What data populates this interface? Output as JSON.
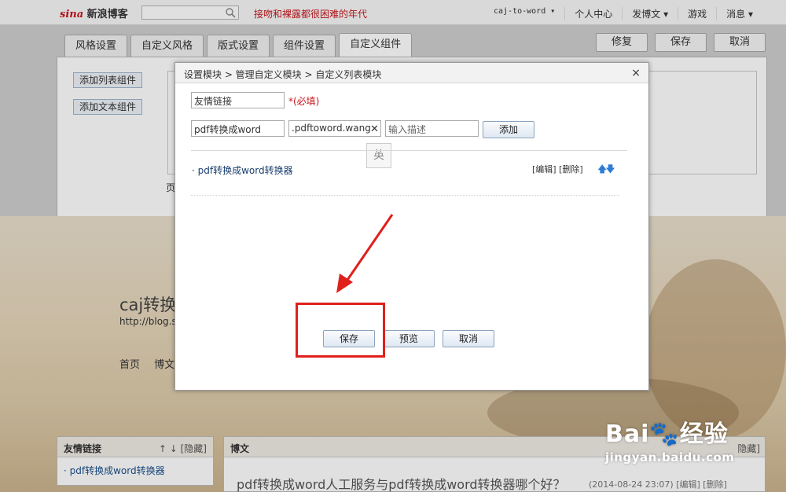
{
  "topbar": {
    "logo_brand": "sina",
    "logo_text": "新浪博客",
    "search_value": "",
    "slogan": "接吻和裸露都很困难的年代",
    "nav": [
      "caj-to-word ▾",
      "个人中心",
      "发博文 ▾",
      "游戏",
      "消息 ▾"
    ]
  },
  "settings": {
    "tabs": [
      "风格设置",
      "自定义风格",
      "版式设置",
      "组件设置",
      "自定义组件"
    ],
    "active_tab": "自定义组件",
    "actions": [
      "修复",
      "保存",
      "取消"
    ],
    "add_list_label": "添加列表组件",
    "add_text_label": "添加文本组件",
    "partial_text": "页"
  },
  "blog": {
    "title": "caj转换",
    "url": "http://blog.s",
    "nav": [
      "首页",
      "博文"
    ],
    "side_title": "友情链接",
    "side_ctl": "↑ ↓ [隐藏]",
    "side_link": "· pdf转换成word转换器",
    "main_title": "博文",
    "main_ctl": "隐藏]",
    "post_title": "pdf转换成word人工服务与pdf转换成word转换器哪个好？",
    "post_meta": "(2014-08-24 23:07) [编辑] [删除]"
  },
  "dialog": {
    "breadcrumb": "设置模块 > 管理自定义模块 > 自定义列表模块",
    "close_label": "×",
    "title_input_value": "友情链接",
    "required_label": "*(必填)",
    "name_input_value": "pdf转换成word",
    "url_input_value": ".pdftoword.wang",
    "desc_input_placeholder": "输入描述",
    "add_button": "添加",
    "ime_label": "英",
    "list_item": "· pdf转换成word转换器",
    "list_ops": "[编辑] [删除]",
    "save_button": "保存",
    "preview_button": "预览",
    "cancel_button": "取消"
  },
  "watermark": {
    "main": "Bai🐾经验",
    "sub": "jingyan.baidu.com"
  },
  "colors": {
    "accent_red": "#e0201b",
    "link_blue": "#1a3e6e",
    "arrow_blue": "#2f7cd4"
  }
}
